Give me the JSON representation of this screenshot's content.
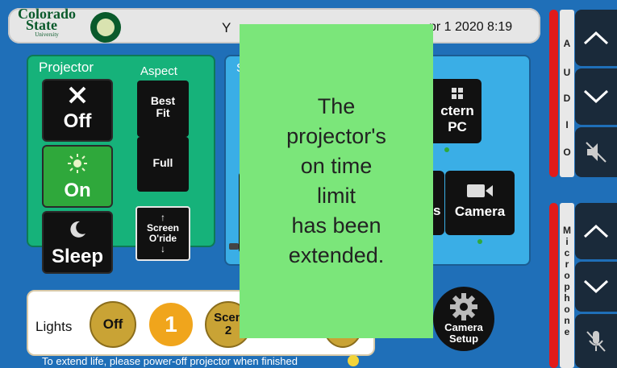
{
  "header": {
    "logo_line1": "Colorado",
    "logo_line2": "State",
    "logo_line3": "University",
    "room": "Y",
    "datetime": "pr 1 2020 8:19"
  },
  "audio": {
    "label_letters": [
      "A",
      "U",
      "D",
      "I",
      "O"
    ],
    "up_icon": "chevron-up-icon",
    "down_icon": "chevron-down-icon",
    "mute_icon": "speaker-muted-icon"
  },
  "microphone": {
    "label_letters": [
      "M",
      "i",
      "c",
      "r",
      "o",
      "p",
      "h",
      "o",
      "n",
      "e"
    ],
    "up_icon": "chevron-up-icon",
    "down_icon": "chevron-down-icon",
    "mute_icon": "mic-muted-icon"
  },
  "projector": {
    "title": "Projector",
    "aspect_title": "Aspect",
    "off_label": "Off",
    "on_label": "On",
    "sleep_label": "Sleep",
    "best_fit_label_line1": "Best",
    "best_fit_label_line2": "Fit",
    "full_label": "Full",
    "screen_override_line1": "Screen",
    "screen_override_line2": "O'ride"
  },
  "source": {
    "title": "S",
    "lectern_pc_line1": "ctern",
    "lectern_pc_line2": "PC",
    "partial_label": "s",
    "camera_label": "Camera"
  },
  "lights": {
    "title": "Lights",
    "off_label": "Off",
    "preset1_label": "1",
    "scene2_line1": "Scen",
    "scene2_line2": "2"
  },
  "camera_setup": {
    "line1": "Camera",
    "line2": "Setup"
  },
  "footer": {
    "note": "To extend life, please power-off projector when finished"
  },
  "dialog": {
    "message": "The\nprojector's\non time\nlimit\nhas been\nextended."
  },
  "colors": {
    "background": "#1f6fb8",
    "projector_panel": "#16b27a",
    "source_panel": "#3aaee6",
    "dialog": "#7be67a",
    "accent_red": "#e11b1b",
    "light_gold": "#c9a335",
    "light_orange": "#f0a51c"
  }
}
